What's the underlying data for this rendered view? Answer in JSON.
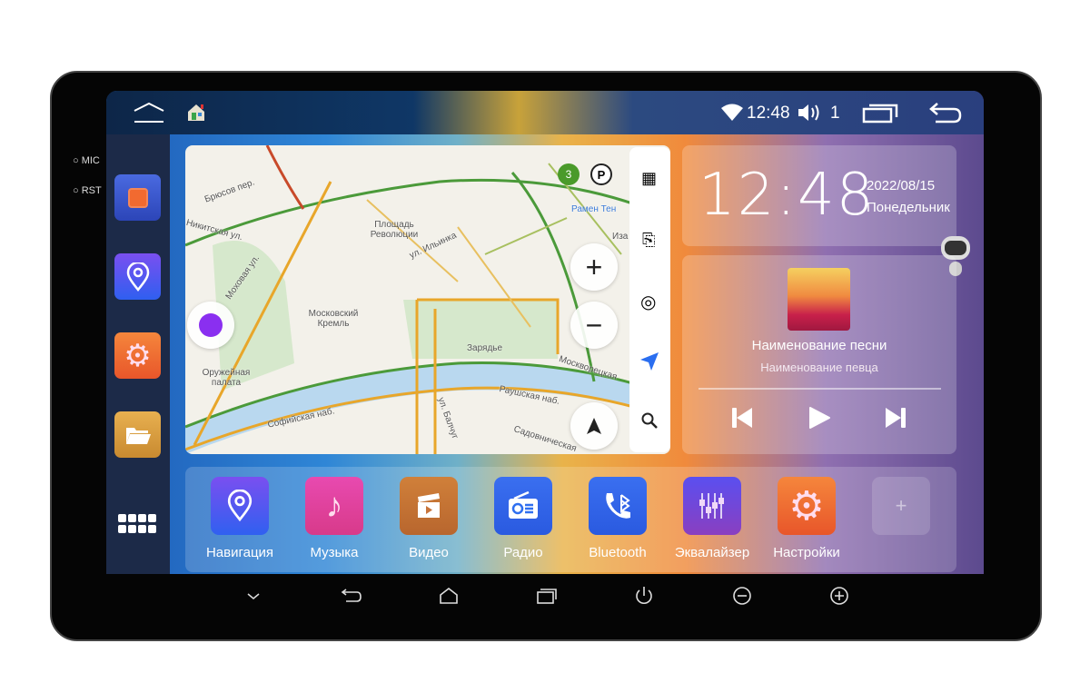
{
  "device": {
    "mic_label": "MIC",
    "rst_label": "RST"
  },
  "statusbar": {
    "time": "12:48",
    "volume_level": "1",
    "icons": [
      "home-outline-icon",
      "launcher-house-icon",
      "wifi-icon",
      "volume-icon",
      "recent-apps-icon",
      "back-icon"
    ]
  },
  "dock": {
    "items": [
      "dvr-camera",
      "navigation",
      "settings",
      "file-manager"
    ],
    "apps_grid": "app-drawer-icon"
  },
  "map": {
    "labels": [
      "Брюсов пер.",
      "Никитская ул.",
      "Моховая ул.",
      "Площадь Революции",
      "ул. Ильинка",
      "Московский Кремль",
      "Оружейная палата",
      "Зарядье",
      "Москворецкая",
      "Раушская наб.",
      "Софийская наб.",
      "ул. Балчуг",
      "Садовническая",
      "Рамен Тен",
      "Иза"
    ],
    "traffic_score": "3",
    "parking_label": "P"
  },
  "clock": {
    "time": "12:48",
    "date": "2022/08/15",
    "weekday": "Понедельник"
  },
  "music": {
    "song": "Наименование песни",
    "artist": "Наименование певца",
    "progress": 0
  },
  "apps": [
    {
      "label": "Навигация",
      "icon": "map-pin-icon",
      "color": "#5b4ff0"
    },
    {
      "label": "Музыка",
      "icon": "music-note-icon",
      "color": "#e0409a"
    },
    {
      "label": "Видео",
      "icon": "clapperboard-icon",
      "color": "#c8743a"
    },
    {
      "label": "Радио",
      "icon": "radio-icon",
      "color": "#2f6ff0"
    },
    {
      "label": "Bluetooth",
      "icon": "bluetooth-phone-icon",
      "color": "#2f6ff0"
    },
    {
      "label": "Эквалайзер",
      "icon": "equalizer-icon",
      "color": "#6a3fd0"
    },
    {
      "label": "Настройки",
      "icon": "gear-icon",
      "color": "#f26a30"
    }
  ],
  "add_app": "+",
  "hardware": [
    "chevron-down",
    "back",
    "home",
    "recent",
    "power",
    "volume-down",
    "volume-up"
  ]
}
